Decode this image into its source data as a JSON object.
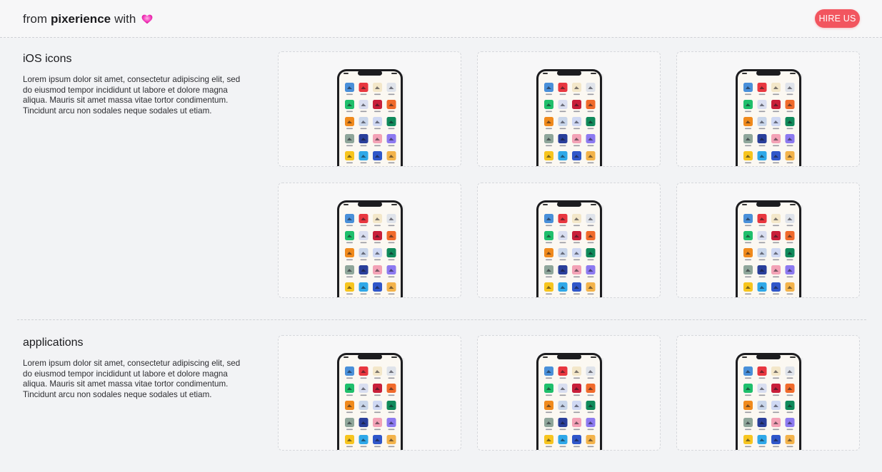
{
  "header": {
    "brand_prefix": "from",
    "brand_name": "pixerience",
    "brand_suffix": "with",
    "heart_icon": "heart-icon",
    "hire_label": "HIRE US",
    "hire_color": "#f2555f"
  },
  "sections": [
    {
      "title": "iOS icons",
      "description": "Lorem ipsum dolor sit amet, consectetur adipiscing elit, sed do eiusmod tempor incididunt ut labore et dolore magna aliqua. Mauris sit amet massa vitae tortor condimentum. Tincidunt arcu non sodales neque sodales ut etiam."
    },
    {
      "title": "applications",
      "description": "Lorem ipsum dolor sit amet, consectetur adipiscing elit, sed do eiusmod tempor incididunt ut labore et dolore magna aliqua. Mauris sit amet massa vitae tortor condimentum. Tincidunt arcu non sodales neque sodales ut etiam."
    }
  ],
  "app_icon_colors": [
    "#4a90d9",
    "#e8373f",
    "#f3e7c9",
    "#dfe3ea",
    "#1fbf6b",
    "#d9def0",
    "#c81f3a",
    "#f06a2a",
    "#f08a1c",
    "#c9d6ea",
    "#cfd8f3",
    "#108a5a",
    "#8fa69a",
    "#2a3f9a",
    "#f3a2b6",
    "#8d7af0",
    "#f7c51e",
    "#2fa8e8",
    "#3057c9",
    "#f3b34a"
  ]
}
